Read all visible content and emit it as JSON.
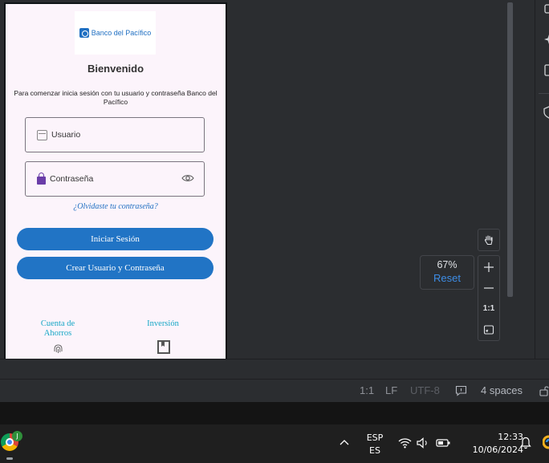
{
  "app": {
    "logo_text": "Banco del Pacífico",
    "welcome_title": "Bienvenido",
    "subtitle": "Para comenzar inicia sesión con tu usuario y contraseña Banco del Pacífico",
    "username_placeholder": "Usuario",
    "password_placeholder": "Contraseña",
    "forgot_link": "¿Olvidaste tu contraseña?",
    "login_button": "Iniciar Sesión",
    "create_button": "Crear Usuario y Contraseña",
    "nav": [
      {
        "label": "Cuenta de Ahorros",
        "icon": "fingerprint-icon"
      },
      {
        "label": "Inversión",
        "icon": "bookmark-icon"
      }
    ]
  },
  "preview_controls": {
    "zoom_level": "67%",
    "reset_label": "Reset",
    "actual_size_label": "1:1"
  },
  "status_bar": {
    "position": "1:1",
    "line_ending": "LF",
    "encoding": "UTF-8",
    "indent": "4 spaces"
  },
  "taskbar": {
    "chrome_badge": "J",
    "language_top": "ESP",
    "language_bottom": "ES",
    "time": "12:33",
    "date": "10/06/2024"
  },
  "colors": {
    "brand_blue": "#2174c5",
    "link_cyan": "#16a7c6",
    "lock_purple": "#6a3da8",
    "ide_background": "#2b2d30",
    "accent_link": "#3d8de6"
  }
}
